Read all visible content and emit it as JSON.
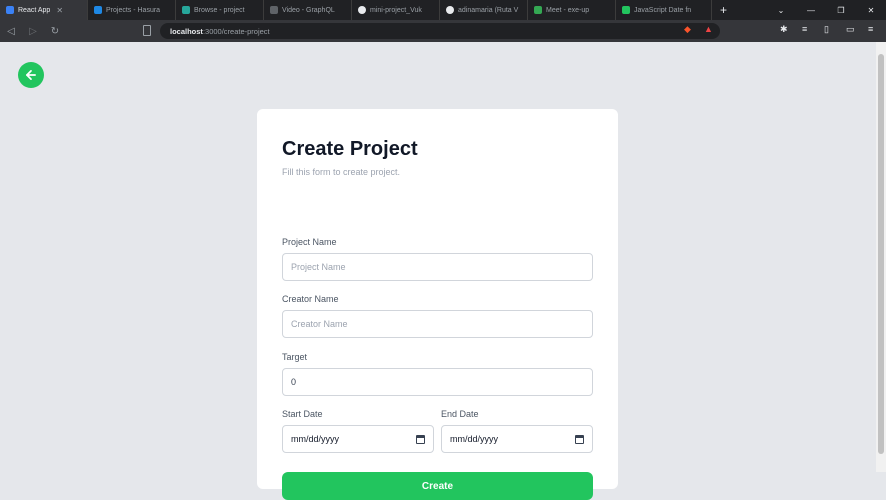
{
  "browser": {
    "tabs": [
      {
        "label": "React App",
        "color": "#3b82f6",
        "active": true
      },
      {
        "label": "Projects - Hasura",
        "color": "#1e88e5",
        "active": false
      },
      {
        "label": "Browse - project",
        "color": "#26a69a",
        "active": false
      },
      {
        "label": "Video - GraphQL",
        "color": "#9aa0a6",
        "active": false
      },
      {
        "label": "mini-project_Vuk",
        "color": "#e8eaed",
        "active": false
      },
      {
        "label": "adinamaria (Ruta V",
        "color": "#e8eaed",
        "active": false
      },
      {
        "label": "Meet - exe-up",
        "color": "#34a853",
        "active": false
      },
      {
        "label": "JavaScript Date fn",
        "color": "#22c55e",
        "active": false
      }
    ],
    "url_host": "localhost",
    "url_path": ":3000/create-project"
  },
  "page": {
    "title": "Create Project",
    "subtitle": "Fill this form to create project.",
    "fields": {
      "project_name": {
        "label": "Project Name",
        "placeholder": "Project Name"
      },
      "creator_name": {
        "label": "Creator Name",
        "placeholder": "Creator Name"
      },
      "target": {
        "label": "Target",
        "value": "0"
      },
      "start_date": {
        "label": "Start Date",
        "value": "mm/dd/yyyy"
      },
      "end_date": {
        "label": "End Date",
        "value": "mm/dd/yyyy"
      }
    },
    "submit_label": "Create",
    "accent_color": "#22c55e"
  }
}
